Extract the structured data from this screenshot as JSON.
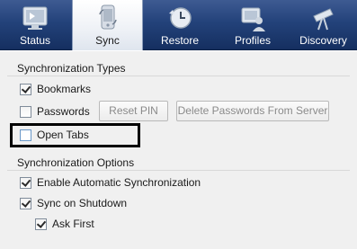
{
  "toolbar": {
    "tabs": [
      {
        "label": "Status",
        "icon": "status-monitor-icon"
      },
      {
        "label": "Sync",
        "icon": "sync-phone-icon",
        "active": true
      },
      {
        "label": "Restore",
        "icon": "restore-clock-icon"
      },
      {
        "label": "Profiles",
        "icon": "profiles-user-icon"
      },
      {
        "label": "Discovery",
        "icon": "discovery-telescope-icon"
      }
    ]
  },
  "sync_types": {
    "title": "Synchronization Types",
    "bookmarks": {
      "label": "Bookmarks",
      "checked": true
    },
    "passwords": {
      "label": "Passwords",
      "checked": false
    },
    "reset_pin_label": "Reset PIN",
    "delete_passwords_label": "Delete Passwords From Server",
    "open_tabs": {
      "label": "Open Tabs",
      "checked": false
    }
  },
  "sync_options": {
    "title": "Synchronization Options",
    "auto_sync": {
      "label": "Enable Automatic Synchronization",
      "checked": true
    },
    "sync_on_shutdown": {
      "label": "Sync on Shutdown",
      "checked": true
    },
    "ask_first": {
      "label": "Ask First",
      "checked": true
    }
  },
  "colors": {
    "toolbar": "#23427a",
    "panel": "#f0f0f0",
    "highlight": "#000000"
  }
}
